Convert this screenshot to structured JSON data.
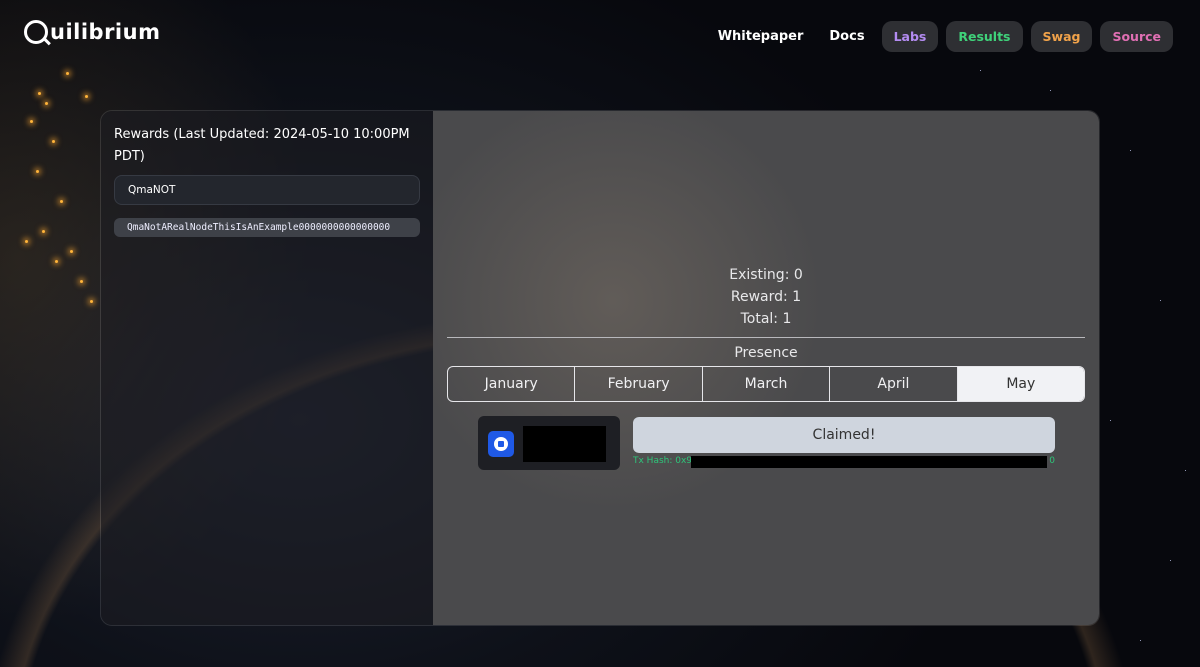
{
  "brand": {
    "name": "uilibrium",
    "logo_icon": "quilibrium-q-icon"
  },
  "nav": {
    "links": [
      "Whitepaper",
      "Docs"
    ],
    "pills": [
      {
        "label": "Labs",
        "color": "#b48cf2"
      },
      {
        "label": "Results",
        "color": "#3fd27a"
      },
      {
        "label": "Swag",
        "color": "#f0a24a"
      },
      {
        "label": "Source",
        "color": "#e06fb3"
      }
    ]
  },
  "rewards": {
    "title": "Rewards (Last Updated: 2024-05-10 10:00PM PDT)",
    "address_value": "QmaNOT",
    "node_id": "QmaNotARealNodeThisIsAnExample0000000000000000"
  },
  "stats": {
    "existing": "Existing: 0",
    "reward": "Reward: 1",
    "total": "Total: 1"
  },
  "presence": {
    "label": "Presence",
    "months": [
      "January",
      "February",
      "March",
      "April",
      "May"
    ],
    "selected": "May"
  },
  "claim": {
    "wallet_icon": "coinbase-wallet-icon",
    "button_label": "Claimed!",
    "tx_prefix": "Tx Hash: 0x9",
    "tx_suffix": "0"
  }
}
